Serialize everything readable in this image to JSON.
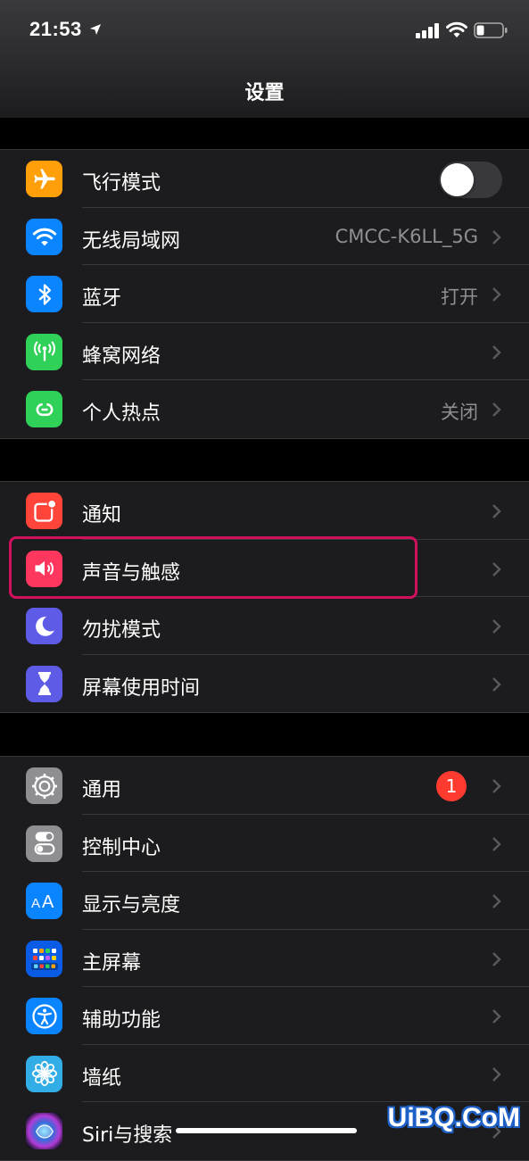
{
  "status_bar": {
    "time": "21:53",
    "icons": [
      "location-arrow-icon",
      "cellular-signal-icon",
      "wifi-signal-icon",
      "battery-icon"
    ]
  },
  "nav": {
    "title": "设置"
  },
  "groups": [
    {
      "rows": [
        {
          "label": "飞行模式",
          "value": "",
          "icon": "airplane-icon",
          "icon_color": "#ff9f0a",
          "toggle": false
        },
        {
          "label": "无线局域网",
          "value": "CMCC-K6LL_5G",
          "icon": "wifi-icon",
          "icon_color": "#0a84ff"
        },
        {
          "label": "蓝牙",
          "value": "打开",
          "icon": "bluetooth-icon",
          "icon_color": "#0a84ff"
        },
        {
          "label": "蜂窝网络",
          "value": "",
          "icon": "cellular-icon",
          "icon_color": "#30d158"
        },
        {
          "label": "个人热点",
          "value": "关闭",
          "icon": "hotspot-icon",
          "icon_color": "#30d158"
        }
      ]
    },
    {
      "rows": [
        {
          "label": "通知",
          "value": "",
          "icon": "notification-icon",
          "icon_color": "#ff453a"
        },
        {
          "label": "声音与触感",
          "value": "",
          "icon": "speaker-icon",
          "icon_color": "#ff375f",
          "highlighted": true
        },
        {
          "label": "勿扰模式",
          "value": "",
          "icon": "moon-icon",
          "icon_color": "#5e5ce6"
        },
        {
          "label": "屏幕使用时间",
          "value": "",
          "icon": "hourglass-icon",
          "icon_color": "#5e5ce6"
        }
      ]
    },
    {
      "rows": [
        {
          "label": "通用",
          "value": "",
          "icon": "gear-icon",
          "icon_color": "#8e8e93",
          "badge": "1"
        },
        {
          "label": "控制中心",
          "value": "",
          "icon": "switches-icon",
          "icon_color": "#8e8e93"
        },
        {
          "label": "显示与亮度",
          "value": "",
          "icon": "text-size-icon",
          "icon_color": "#0a84ff"
        },
        {
          "label": "主屏幕",
          "value": "",
          "icon": "home-screen-icon",
          "icon_color": "#0a5ce6"
        },
        {
          "label": "辅助功能",
          "value": "",
          "icon": "accessibility-icon",
          "icon_color": "#0a84ff"
        },
        {
          "label": "墙纸",
          "value": "",
          "icon": "wallpaper-flower-icon",
          "icon_color": "#32ade6"
        },
        {
          "label": "Siri与搜索",
          "value": "",
          "icon": "siri-icon",
          "icon_color": "#1c1c1e"
        }
      ]
    }
  ],
  "highlight_color": "#d0115e",
  "watermark": "UiBQ.CoM"
}
